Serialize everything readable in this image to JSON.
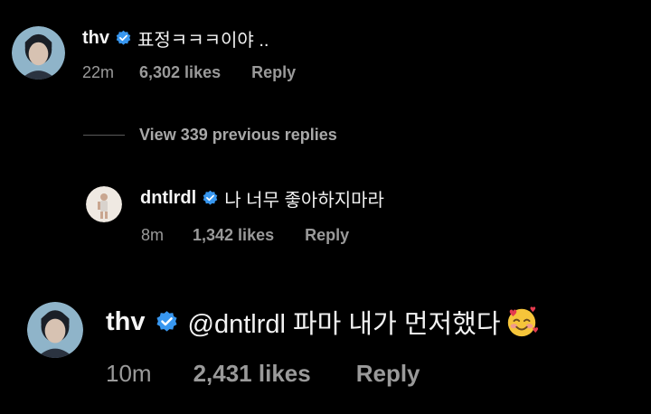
{
  "comments": [
    {
      "username": "thv",
      "text": "표정ㅋㅋㅋ이야 ..",
      "time": "22m",
      "likes": "6,302 likes",
      "reply": "Reply"
    },
    {
      "username": "dntlrdl",
      "text": "나 너무 좋아하지마라",
      "time": "8m",
      "likes": "1,342 likes",
      "reply": "Reply"
    },
    {
      "username": "thv",
      "text": "@dntlrdl 파마 내가 먼저했다",
      "time": "10m",
      "likes": "2,431 likes",
      "reply": "Reply"
    }
  ],
  "view_replies": "View 339 previous replies",
  "icons": {
    "verified": "verified-badge-icon",
    "emoji": "smiling-face-with-hearts-icon"
  },
  "colors": {
    "background": "#000000",
    "verified": "#3897f0",
    "meta": "#9a9a9a"
  }
}
